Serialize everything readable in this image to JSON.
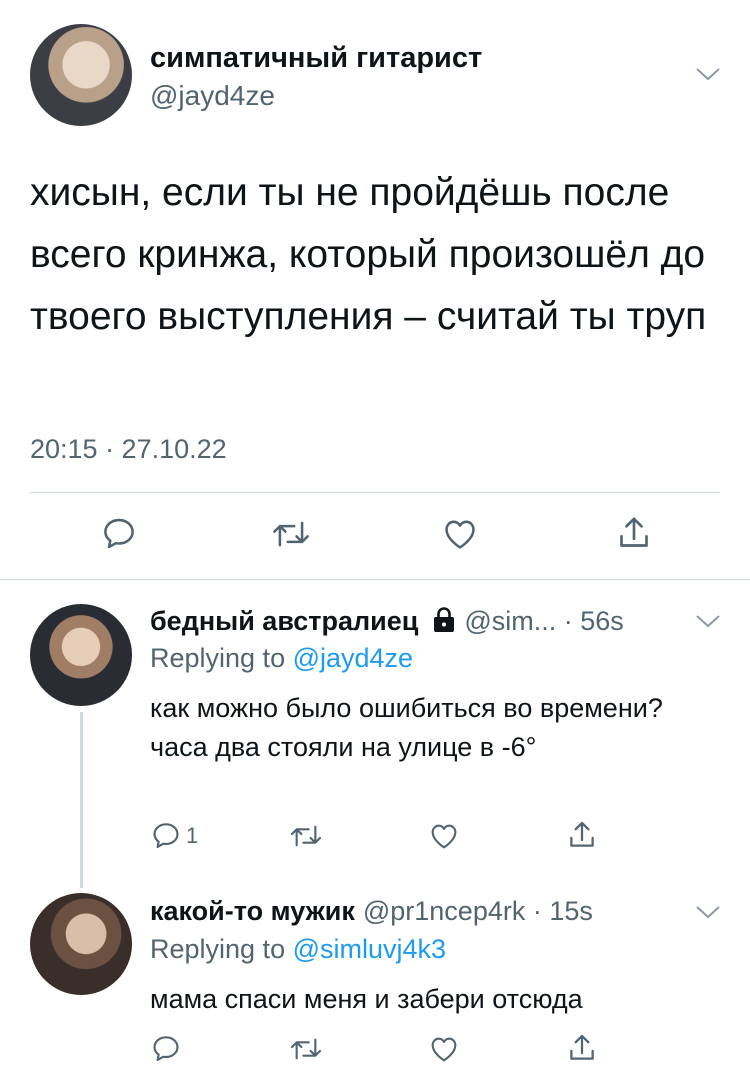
{
  "main_tweet": {
    "author_name": "симпатичный гитарист",
    "author_handle": "@jayd4ze",
    "text": "хисын, если ты не пройдёшь после всего кринжа, который произошёл до твоего выступления – считай ты труп",
    "timestamp": "20:15 · 27.10.22",
    "actions": [
      {
        "icon": "reply-icon"
      },
      {
        "icon": "retweet-icon"
      },
      {
        "icon": "like-icon"
      },
      {
        "icon": "share-icon"
      }
    ]
  },
  "replies": [
    {
      "author_name": "бедный австралиец",
      "protected_icon": "lock-icon",
      "meta": "@sim... · 56s",
      "replying_prefix": "Replying to ",
      "replying_to": "@jayd4ze",
      "text": "как можно было ошибиться во времени? часа два стояли на улице в -6°",
      "reply_count": "1"
    },
    {
      "author_name": "какой-то мужик",
      "meta": "@pr1ncep4rk · 15s",
      "replying_prefix": "Replying to ",
      "replying_to": "@simluvj4k3",
      "text": "мама спаси меня и забери отсюда",
      "reply_count": ""
    }
  ],
  "colors": {
    "text_primary": "#0f1419",
    "text_secondary": "#536471",
    "link": "#1d9bf0",
    "divider": "#cfd9de"
  }
}
